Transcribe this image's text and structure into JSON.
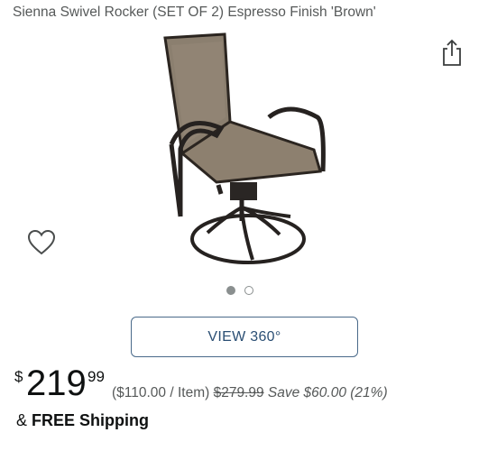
{
  "product": {
    "title": "Sienna Swivel Rocker (SET OF 2) Espresso Finish 'Brown'",
    "image_alt": "Swivel rocker patio chair with brown sling seat"
  },
  "icons": {
    "share": "share-icon",
    "wishlist": "heart-icon"
  },
  "carousel": {
    "total": 2,
    "active_index": 0
  },
  "view360": {
    "label": "VIEW 360°"
  },
  "price": {
    "currency": "$",
    "whole": "219",
    "fraction": "99",
    "per_item": "($110.00 / Item)",
    "list_price": "$279.99",
    "savings": "Save $60.00 (21%)"
  },
  "shipping": {
    "prefix": "& ",
    "label": "FREE Shipping"
  },
  "colors": {
    "title": "#565959",
    "text": "#0f1111",
    "button_border": "#4a6a8a",
    "button_text": "#2b4f74",
    "dot": "#8a8f8f"
  }
}
